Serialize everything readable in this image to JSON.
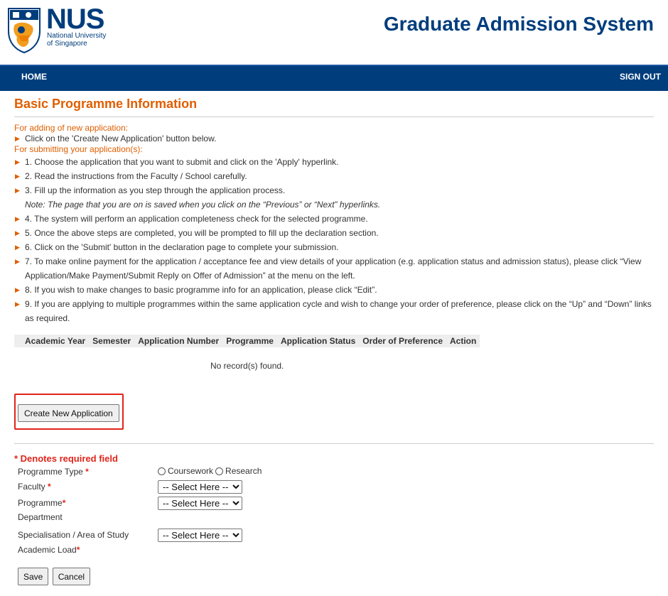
{
  "logo": {
    "word": "NUS",
    "sub_line1": "National University",
    "sub_line2": "of Singapore"
  },
  "header": {
    "title": "Graduate Admission System"
  },
  "nav": {
    "home": "HOME",
    "signout": "SIGN OUT"
  },
  "page": {
    "title": "Basic Programme Information"
  },
  "instructions": {
    "adding_heading": "For adding of new application:",
    "adding_item": "Click on the 'Create New Application' button below.",
    "submitting_heading": "For submitting your application(s):",
    "steps": [
      "1. Choose the application that you want to submit and click on the 'Apply' hyperlink.",
      "2. Read the instructions from the Faculty / School carefully.",
      "3. Fill up the information as you step through the application process.",
      "4. The system will perform an application completeness check for the selected programme.",
      "5. Once the above steps are completed, you will be prompted to fill up the declaration section.",
      "6. Click on the 'Submit' button in the declaration page to complete your submission.",
      "7. To make online payment for the application / acceptance fee and view details of your application (e.g. application status and admission status), please click “View Application/Make Payment/Submit Reply on Offer of Admission” at the menu on the left.",
      "8. If you wish to make changes to basic programme info for an application, please click “Edit”.",
      "9. If you are applying to multiple programmes within the same application cycle and wish to change your order of preference, please click on the “Up” and “Down” links as required."
    ],
    "note": "Note: The page that you are on is saved when you click on the “Previous” or “Next” hyperlinks."
  },
  "table": {
    "columns": [
      "Academic Year",
      "Semester",
      "Application Number",
      "Programme",
      "Application Status",
      "Order of Preference",
      "Action"
    ],
    "empty_text": "No record(s) found."
  },
  "create_button": "Create New Application",
  "form": {
    "required_note": "* Denotes required field",
    "programme_type_label": "Programme Type",
    "programme_type_options": [
      "Coursework",
      "Research"
    ],
    "faculty_label": "Faculty",
    "programme_label": "Programme",
    "department_label": "Department",
    "specialisation_label": "Specialisation / Area of Study",
    "academic_load_label": "Academic Load",
    "select_placeholder": "-- Select Here --",
    "required_mark": "*"
  },
  "buttons": {
    "save": "Save",
    "cancel": "Cancel"
  },
  "colors": {
    "brand_blue": "#003d7c",
    "accent_orange": "#e05e00",
    "required_red": "#e0241a"
  },
  "icons": {
    "bullet": "orange-triangle-arrow",
    "logo": "nus-lion-crest"
  }
}
